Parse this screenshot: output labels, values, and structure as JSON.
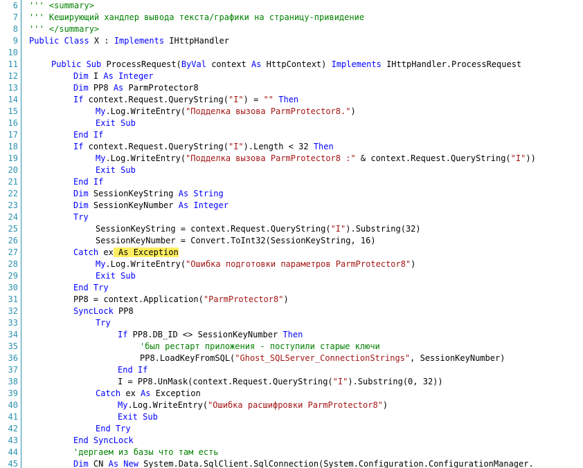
{
  "editor": {
    "colors": {
      "keyword": "#0000ff",
      "comment": "#008000",
      "string": "#a31515",
      "text": "#000000",
      "line_number": "#2b91af",
      "highlight": "#ffef60"
    },
    "lines": [
      {
        "n": "6",
        "indent": 0,
        "tokens": [
          [
            "cm",
            "''' <summary>"
          ]
        ]
      },
      {
        "n": "7",
        "indent": 0,
        "tokens": [
          [
            "cm",
            "''' Кеширующий хандлер вывода текста/графики на страницу-привидение"
          ]
        ]
      },
      {
        "n": "8",
        "indent": 0,
        "tokens": [
          [
            "cm",
            "''' </summary>"
          ]
        ]
      },
      {
        "n": "9",
        "indent": 0,
        "tokens": [
          [
            "kw",
            "Public Class"
          ],
          [
            "tx",
            " X : "
          ],
          [
            "kw",
            "Implements"
          ],
          [
            "tx",
            " IHttpHandler"
          ]
        ]
      },
      {
        "n": "10",
        "indent": 0,
        "tokens": []
      },
      {
        "n": "11",
        "indent": 1,
        "tokens": [
          [
            "kw",
            "Public Sub"
          ],
          [
            "tx",
            " ProcessRequest("
          ],
          [
            "kw",
            "ByVal"
          ],
          [
            "tx",
            " context "
          ],
          [
            "kw",
            "As"
          ],
          [
            "tx",
            " HttpContext) "
          ],
          [
            "kw",
            "Implements"
          ],
          [
            "tx",
            " IHttpHandler.ProcessRequest"
          ]
        ]
      },
      {
        "n": "12",
        "indent": 2,
        "tokens": [
          [
            "kw",
            "Dim"
          ],
          [
            "tx",
            " I "
          ],
          [
            "kw",
            "As Integer"
          ]
        ]
      },
      {
        "n": "13",
        "indent": 2,
        "tokens": [
          [
            "kw",
            "Dim"
          ],
          [
            "tx",
            " PP8 "
          ],
          [
            "kw",
            "As"
          ],
          [
            "tx",
            " ParmProtector8"
          ]
        ]
      },
      {
        "n": "14",
        "indent": 2,
        "tokens": [
          [
            "kw",
            "If"
          ],
          [
            "tx",
            " context.Request.QueryString("
          ],
          [
            "st",
            "\"I\""
          ],
          [
            "tx",
            ") = "
          ],
          [
            "st",
            "\"\""
          ],
          [
            "tx",
            " "
          ],
          [
            "kw",
            "Then"
          ]
        ]
      },
      {
        "n": "15",
        "indent": 3,
        "tokens": [
          [
            "kw",
            "My"
          ],
          [
            "tx",
            ".Log.WriteEntry("
          ],
          [
            "st",
            "\"Подделка вызова ParmProtector8.\""
          ],
          [
            "tx",
            ")"
          ]
        ]
      },
      {
        "n": "16",
        "indent": 3,
        "tokens": [
          [
            "kw",
            "Exit Sub"
          ]
        ]
      },
      {
        "n": "17",
        "indent": 2,
        "tokens": [
          [
            "kw",
            "End If"
          ]
        ]
      },
      {
        "n": "18",
        "indent": 2,
        "tokens": [
          [
            "kw",
            "If"
          ],
          [
            "tx",
            " context.Request.QueryString("
          ],
          [
            "st",
            "\"I\""
          ],
          [
            "tx",
            ").Length < 32 "
          ],
          [
            "kw",
            "Then"
          ]
        ]
      },
      {
        "n": "19",
        "indent": 3,
        "tokens": [
          [
            "kw",
            "My"
          ],
          [
            "tx",
            ".Log.WriteEntry("
          ],
          [
            "st",
            "\"Подделка вызова ParmProtector8 :\""
          ],
          [
            "tx",
            " & context.Request.QueryString("
          ],
          [
            "st",
            "\"I\""
          ],
          [
            "tx",
            "))"
          ]
        ]
      },
      {
        "n": "20",
        "indent": 3,
        "tokens": [
          [
            "kw",
            "Exit Sub"
          ]
        ]
      },
      {
        "n": "21",
        "indent": 2,
        "tokens": [
          [
            "kw",
            "End If"
          ]
        ]
      },
      {
        "n": "22",
        "indent": 2,
        "tokens": [
          [
            "kw",
            "Dim"
          ],
          [
            "tx",
            " SessionKeyString "
          ],
          [
            "kw",
            "As String"
          ]
        ]
      },
      {
        "n": "23",
        "indent": 2,
        "tokens": [
          [
            "kw",
            "Dim"
          ],
          [
            "tx",
            " SessionKeyNumber "
          ],
          [
            "kw",
            "As Integer"
          ]
        ]
      },
      {
        "n": "24",
        "indent": 2,
        "tokens": [
          [
            "kw",
            "Try"
          ]
        ]
      },
      {
        "n": "25",
        "indent": 3,
        "tokens": [
          [
            "tx",
            "SessionKeyString = context.Request.QueryString("
          ],
          [
            "st",
            "\"I\""
          ],
          [
            "tx",
            ").Substring(32)"
          ]
        ]
      },
      {
        "n": "26",
        "indent": 3,
        "tokens": [
          [
            "tx",
            "SessionKeyNumber = Convert.ToInt32(SessionKeyString, 16)"
          ]
        ]
      },
      {
        "n": "27",
        "indent": 2,
        "tokens": [
          [
            "kw",
            "Catch"
          ],
          [
            "tx",
            " ex"
          ],
          [
            "hl",
            " As Exception"
          ]
        ]
      },
      {
        "n": "28",
        "indent": 3,
        "tokens": [
          [
            "kw",
            "My"
          ],
          [
            "tx",
            ".Log.WriteEntry("
          ],
          [
            "st",
            "\"Ошибка подготовки параметров ParmProtector8\""
          ],
          [
            "tx",
            ")"
          ]
        ]
      },
      {
        "n": "29",
        "indent": 3,
        "tokens": [
          [
            "kw",
            "Exit Sub"
          ]
        ]
      },
      {
        "n": "30",
        "indent": 2,
        "tokens": [
          [
            "kw",
            "End Try"
          ]
        ]
      },
      {
        "n": "31",
        "indent": 2,
        "tokens": [
          [
            "tx",
            "PP8 = context.Application("
          ],
          [
            "st",
            "\"ParmProtector8\""
          ],
          [
            "tx",
            ")"
          ]
        ]
      },
      {
        "n": "32",
        "indent": 2,
        "tokens": [
          [
            "kw",
            "SyncLock"
          ],
          [
            "tx",
            " PP8"
          ]
        ]
      },
      {
        "n": "33",
        "indent": 3,
        "tokens": [
          [
            "kw",
            "Try"
          ]
        ]
      },
      {
        "n": "34",
        "indent": 4,
        "tokens": [
          [
            "kw",
            "If"
          ],
          [
            "tx",
            " PP8.DB_ID <> SessionKeyNumber "
          ],
          [
            "kw",
            "Then"
          ]
        ]
      },
      {
        "n": "35",
        "indent": 5,
        "tokens": [
          [
            "cm",
            "'был рестарт приложения - поступили старые ключи"
          ]
        ]
      },
      {
        "n": "36",
        "indent": 5,
        "tokens": [
          [
            "tx",
            "PP8.LoadKeyFromSQL("
          ],
          [
            "st",
            "\"Ghost_SQLServer_ConnectionStrings\""
          ],
          [
            "tx",
            ", SessionKeyNumber)"
          ]
        ]
      },
      {
        "n": "37",
        "indent": 4,
        "tokens": [
          [
            "kw",
            "End If"
          ]
        ]
      },
      {
        "n": "38",
        "indent": 4,
        "tokens": [
          [
            "tx",
            "I = PP8.UnMask(context.Request.QueryString("
          ],
          [
            "st",
            "\"I\""
          ],
          [
            "tx",
            ").Substring(0, 32))"
          ]
        ]
      },
      {
        "n": "39",
        "indent": 3,
        "tokens": [
          [
            "kw",
            "Catch"
          ],
          [
            "tx",
            " ex "
          ],
          [
            "kw",
            "As"
          ],
          [
            "tx",
            " Exception"
          ]
        ]
      },
      {
        "n": "40",
        "indent": 4,
        "tokens": [
          [
            "kw",
            "My"
          ],
          [
            "tx",
            ".Log.WriteEntry("
          ],
          [
            "st",
            "\"Ошибка расшифровки ParmProtector8\""
          ],
          [
            "tx",
            ")"
          ]
        ]
      },
      {
        "n": "41",
        "indent": 4,
        "tokens": [
          [
            "kw",
            "Exit Sub"
          ]
        ]
      },
      {
        "n": "42",
        "indent": 3,
        "tokens": [
          [
            "kw",
            "End Try"
          ]
        ]
      },
      {
        "n": "43",
        "indent": 2,
        "tokens": [
          [
            "kw",
            "End SyncLock"
          ]
        ]
      },
      {
        "n": "44",
        "indent": 2,
        "tokens": [
          [
            "cm",
            "'дергаем из базы что там есть"
          ]
        ]
      },
      {
        "n": "45",
        "indent": 2,
        "tokens": [
          [
            "kw",
            "Dim"
          ],
          [
            "tx",
            " CN "
          ],
          [
            "kw",
            "As New"
          ],
          [
            "tx",
            " System.Data.SqlClient.SqlConnection(System.Configuration.ConfigurationManager."
          ]
        ]
      }
    ]
  }
}
